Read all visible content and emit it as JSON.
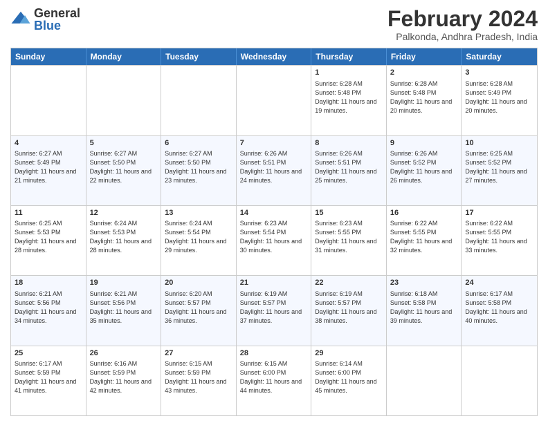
{
  "logo": {
    "general": "General",
    "blue": "Blue"
  },
  "header": {
    "month_year": "February 2024",
    "location": "Palkonda, Andhra Pradesh, India"
  },
  "days_of_week": [
    "Sunday",
    "Monday",
    "Tuesday",
    "Wednesday",
    "Thursday",
    "Friday",
    "Saturday"
  ],
  "rows": [
    {
      "alt": false,
      "cells": [
        {
          "day": "",
          "info": ""
        },
        {
          "day": "",
          "info": ""
        },
        {
          "day": "",
          "info": ""
        },
        {
          "day": "",
          "info": ""
        },
        {
          "day": "1",
          "info": "Sunrise: 6:28 AM\nSunset: 5:48 PM\nDaylight: 11 hours and 19 minutes."
        },
        {
          "day": "2",
          "info": "Sunrise: 6:28 AM\nSunset: 5:48 PM\nDaylight: 11 hours and 20 minutes."
        },
        {
          "day": "3",
          "info": "Sunrise: 6:28 AM\nSunset: 5:49 PM\nDaylight: 11 hours and 20 minutes."
        }
      ]
    },
    {
      "alt": true,
      "cells": [
        {
          "day": "4",
          "info": "Sunrise: 6:27 AM\nSunset: 5:49 PM\nDaylight: 11 hours and 21 minutes."
        },
        {
          "day": "5",
          "info": "Sunrise: 6:27 AM\nSunset: 5:50 PM\nDaylight: 11 hours and 22 minutes."
        },
        {
          "day": "6",
          "info": "Sunrise: 6:27 AM\nSunset: 5:50 PM\nDaylight: 11 hours and 23 minutes."
        },
        {
          "day": "7",
          "info": "Sunrise: 6:26 AM\nSunset: 5:51 PM\nDaylight: 11 hours and 24 minutes."
        },
        {
          "day": "8",
          "info": "Sunrise: 6:26 AM\nSunset: 5:51 PM\nDaylight: 11 hours and 25 minutes."
        },
        {
          "day": "9",
          "info": "Sunrise: 6:26 AM\nSunset: 5:52 PM\nDaylight: 11 hours and 26 minutes."
        },
        {
          "day": "10",
          "info": "Sunrise: 6:25 AM\nSunset: 5:52 PM\nDaylight: 11 hours and 27 minutes."
        }
      ]
    },
    {
      "alt": false,
      "cells": [
        {
          "day": "11",
          "info": "Sunrise: 6:25 AM\nSunset: 5:53 PM\nDaylight: 11 hours and 28 minutes."
        },
        {
          "day": "12",
          "info": "Sunrise: 6:24 AM\nSunset: 5:53 PM\nDaylight: 11 hours and 28 minutes."
        },
        {
          "day": "13",
          "info": "Sunrise: 6:24 AM\nSunset: 5:54 PM\nDaylight: 11 hours and 29 minutes."
        },
        {
          "day": "14",
          "info": "Sunrise: 6:23 AM\nSunset: 5:54 PM\nDaylight: 11 hours and 30 minutes."
        },
        {
          "day": "15",
          "info": "Sunrise: 6:23 AM\nSunset: 5:55 PM\nDaylight: 11 hours and 31 minutes."
        },
        {
          "day": "16",
          "info": "Sunrise: 6:22 AM\nSunset: 5:55 PM\nDaylight: 11 hours and 32 minutes."
        },
        {
          "day": "17",
          "info": "Sunrise: 6:22 AM\nSunset: 5:55 PM\nDaylight: 11 hours and 33 minutes."
        }
      ]
    },
    {
      "alt": true,
      "cells": [
        {
          "day": "18",
          "info": "Sunrise: 6:21 AM\nSunset: 5:56 PM\nDaylight: 11 hours and 34 minutes."
        },
        {
          "day": "19",
          "info": "Sunrise: 6:21 AM\nSunset: 5:56 PM\nDaylight: 11 hours and 35 minutes."
        },
        {
          "day": "20",
          "info": "Sunrise: 6:20 AM\nSunset: 5:57 PM\nDaylight: 11 hours and 36 minutes."
        },
        {
          "day": "21",
          "info": "Sunrise: 6:19 AM\nSunset: 5:57 PM\nDaylight: 11 hours and 37 minutes."
        },
        {
          "day": "22",
          "info": "Sunrise: 6:19 AM\nSunset: 5:57 PM\nDaylight: 11 hours and 38 minutes."
        },
        {
          "day": "23",
          "info": "Sunrise: 6:18 AM\nSunset: 5:58 PM\nDaylight: 11 hours and 39 minutes."
        },
        {
          "day": "24",
          "info": "Sunrise: 6:17 AM\nSunset: 5:58 PM\nDaylight: 11 hours and 40 minutes."
        }
      ]
    },
    {
      "alt": false,
      "cells": [
        {
          "day": "25",
          "info": "Sunrise: 6:17 AM\nSunset: 5:59 PM\nDaylight: 11 hours and 41 minutes."
        },
        {
          "day": "26",
          "info": "Sunrise: 6:16 AM\nSunset: 5:59 PM\nDaylight: 11 hours and 42 minutes."
        },
        {
          "day": "27",
          "info": "Sunrise: 6:15 AM\nSunset: 5:59 PM\nDaylight: 11 hours and 43 minutes."
        },
        {
          "day": "28",
          "info": "Sunrise: 6:15 AM\nSunset: 6:00 PM\nDaylight: 11 hours and 44 minutes."
        },
        {
          "day": "29",
          "info": "Sunrise: 6:14 AM\nSunset: 6:00 PM\nDaylight: 11 hours and 45 minutes."
        },
        {
          "day": "",
          "info": ""
        },
        {
          "day": "",
          "info": ""
        }
      ]
    }
  ]
}
